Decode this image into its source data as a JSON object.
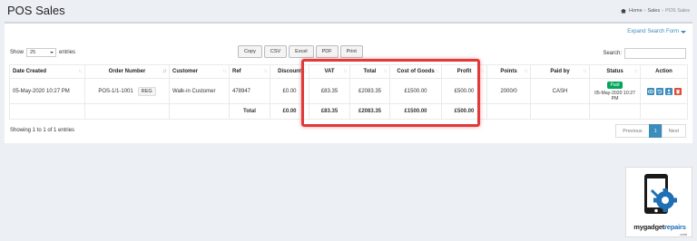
{
  "header": {
    "title": "POS Sales"
  },
  "breadcrumb": {
    "home": "Home",
    "sep1": "›",
    "sales": "Sales",
    "sep2": "›",
    "current": "POS Sales"
  },
  "panel": {
    "expand_label": "Expand Search Form",
    "show_label": "Show",
    "entries_value": "25",
    "entries_label": "entries",
    "search_label": "Search:",
    "buttons": {
      "copy": "Copy",
      "csv": "CSV",
      "excel": "Excel",
      "pdf": "PDF",
      "print": "Print"
    }
  },
  "table": {
    "columns": [
      "Date Created",
      "Order Number",
      "Customer",
      "Ref",
      "Discount",
      "VAT",
      "Total",
      "Cost of Goods",
      "Profit",
      "Points",
      "Paid by",
      "Status",
      "Action"
    ],
    "row": {
      "date_created": "05-May-2020 10:27 PM",
      "order_number": "POS-1/1-1001",
      "order_tag": "REG",
      "customer": "Walk-in Customer",
      "ref": "478947",
      "discount": "£0.00",
      "vat": "£83.35",
      "total": "£2083.35",
      "cost_of_goods": "£1500.00",
      "profit": "£500.00",
      "points": "2000/0",
      "paid_by": "CASH",
      "status_badge": "Paid",
      "status_date": "05-May-2020 10:27 PM"
    },
    "totals": {
      "label": "Total",
      "discount": "£0.00",
      "vat": "£83.35",
      "total": "£2083.35",
      "cost_of_goods": "£1500.00",
      "profit": "£500.00"
    }
  },
  "footer": {
    "info": "Showing 1 to 1 of 1 entries",
    "previous": "Previous",
    "page": "1",
    "next": "Next"
  },
  "logo": {
    "word1": "mygadget",
    "word2": "repairs",
    "sub": ".com"
  },
  "colors": {
    "accent": "#3c8dbc",
    "paid": "#00a65a",
    "delete": "#dd4b39",
    "highlight": "#e03a3a"
  }
}
